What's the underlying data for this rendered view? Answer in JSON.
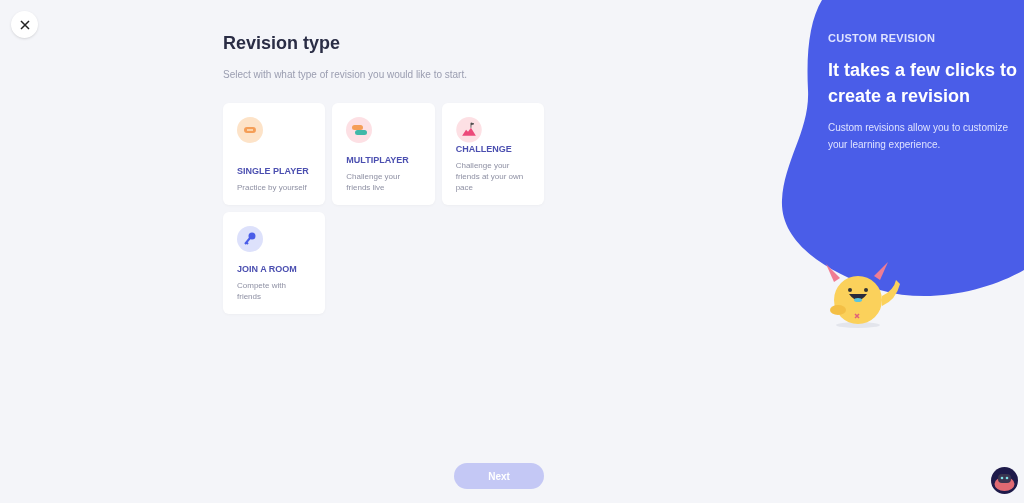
{
  "heading": "Revision type",
  "subtitle": "Select with what type of revision you would like to start.",
  "options": [
    {
      "kind": "single",
      "title": "SINGLE PLAYER",
      "description": "Practice by yourself"
    },
    {
      "kind": "multi",
      "title": "MULTIPLAYER",
      "description": "Challenge your friends live"
    },
    {
      "kind": "challenge",
      "title": "CHALLENGE",
      "description": "Challenge your friends at your own pace"
    },
    {
      "kind": "room",
      "title": "JOIN A ROOM",
      "description": "Compete with friends"
    }
  ],
  "next_button": {
    "label": "Next",
    "disabled": true
  },
  "promo": {
    "eyebrow": "CUSTOM REVISION",
    "title": "It takes a few clicks to create a revision",
    "body": "Custom revisions allow you to customize your learning experience."
  }
}
